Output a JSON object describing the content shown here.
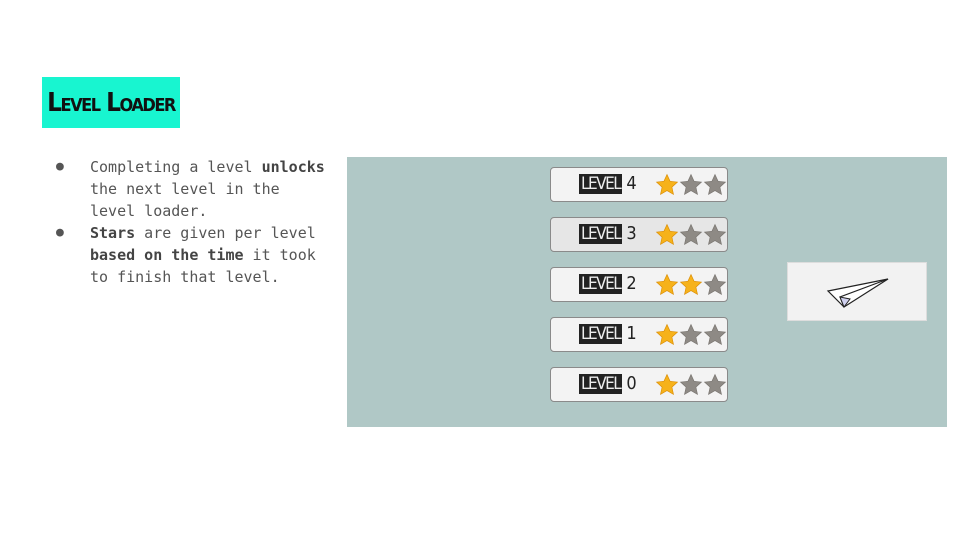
{
  "slide": {
    "title": "Level Loader",
    "title_bg": "#18f5d0"
  },
  "bullets": [
    {
      "parts": [
        {
          "text": "Completing a level ",
          "bold": false
        },
        {
          "text": "unlocks",
          "bold": true
        },
        {
          "text": " the next level in the level loader.",
          "bold": false
        }
      ]
    },
    {
      "parts": [
        {
          "text": "Stars",
          "bold": true
        },
        {
          "text": " are given per level ",
          "bold": false
        },
        {
          "text": "based on the time",
          "bold": true
        },
        {
          "text": " it took to finish that level.",
          "bold": false
        }
      ]
    }
  ],
  "level_loader": {
    "panel_color": "#b0c8c6",
    "levels": [
      {
        "label": "LEVEL 4",
        "level_word": "LEVEL",
        "number": "4",
        "stars_earned": 1,
        "stars_total": 3
      },
      {
        "label": "LEVEL 3",
        "level_word": "LEVEL",
        "number": "3",
        "stars_earned": 1,
        "stars_total": 3
      },
      {
        "label": "LEVEL 2",
        "level_word": "LEVEL",
        "number": "2",
        "stars_earned": 2,
        "stars_total": 3
      },
      {
        "label": "LEVEL 1",
        "level_word": "LEVEL",
        "number": "1",
        "stars_earned": 1,
        "stars_total": 3
      },
      {
        "label": "LEVEL 0",
        "level_word": "LEVEL",
        "number": "0",
        "stars_earned": 1,
        "stars_total": 3
      }
    ],
    "star_colors": {
      "earned": "#f6b21b",
      "empty": "#8e8a85"
    },
    "icon": "paper-plane-icon"
  }
}
